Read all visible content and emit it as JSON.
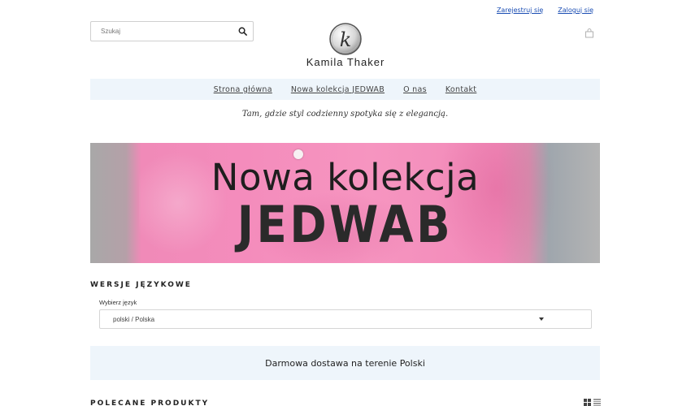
{
  "header": {
    "register_link": "Zarejestruj się",
    "login_link": "Zaloguj się",
    "search": {
      "placeholder": "Szukaj",
      "icon": "search-icon"
    },
    "logo": {
      "monogram": "k",
      "text": "Kamila Thaker"
    },
    "cart_icon": "bag-icon"
  },
  "nav": {
    "items": [
      {
        "label": "Strona główna"
      },
      {
        "label": "Nowa kolekcja JEDWAB"
      },
      {
        "label": "O nas"
      },
      {
        "label": "Kontakt"
      }
    ]
  },
  "tagline": "Tam, gdzie styl codzienny spotyka się z elegancją.",
  "banner": {
    "line1": "Nowa kolekcja",
    "line2": "JEDWAB",
    "background_color": "#f48cbc"
  },
  "language_section": {
    "title": "WERSJE JĘZYKOWE",
    "label": "Wybierz język",
    "selected": "polski / Polska"
  },
  "shipping_notice": "Darmowa dostawa na terenie Polski",
  "featured_section": {
    "title": "POLECANE PRODUKTY",
    "view_icons": [
      "grid-view-icon",
      "list-view-icon"
    ]
  },
  "colors": {
    "nav_background": "#eef5fb",
    "link_blue": "#1a4db3"
  }
}
